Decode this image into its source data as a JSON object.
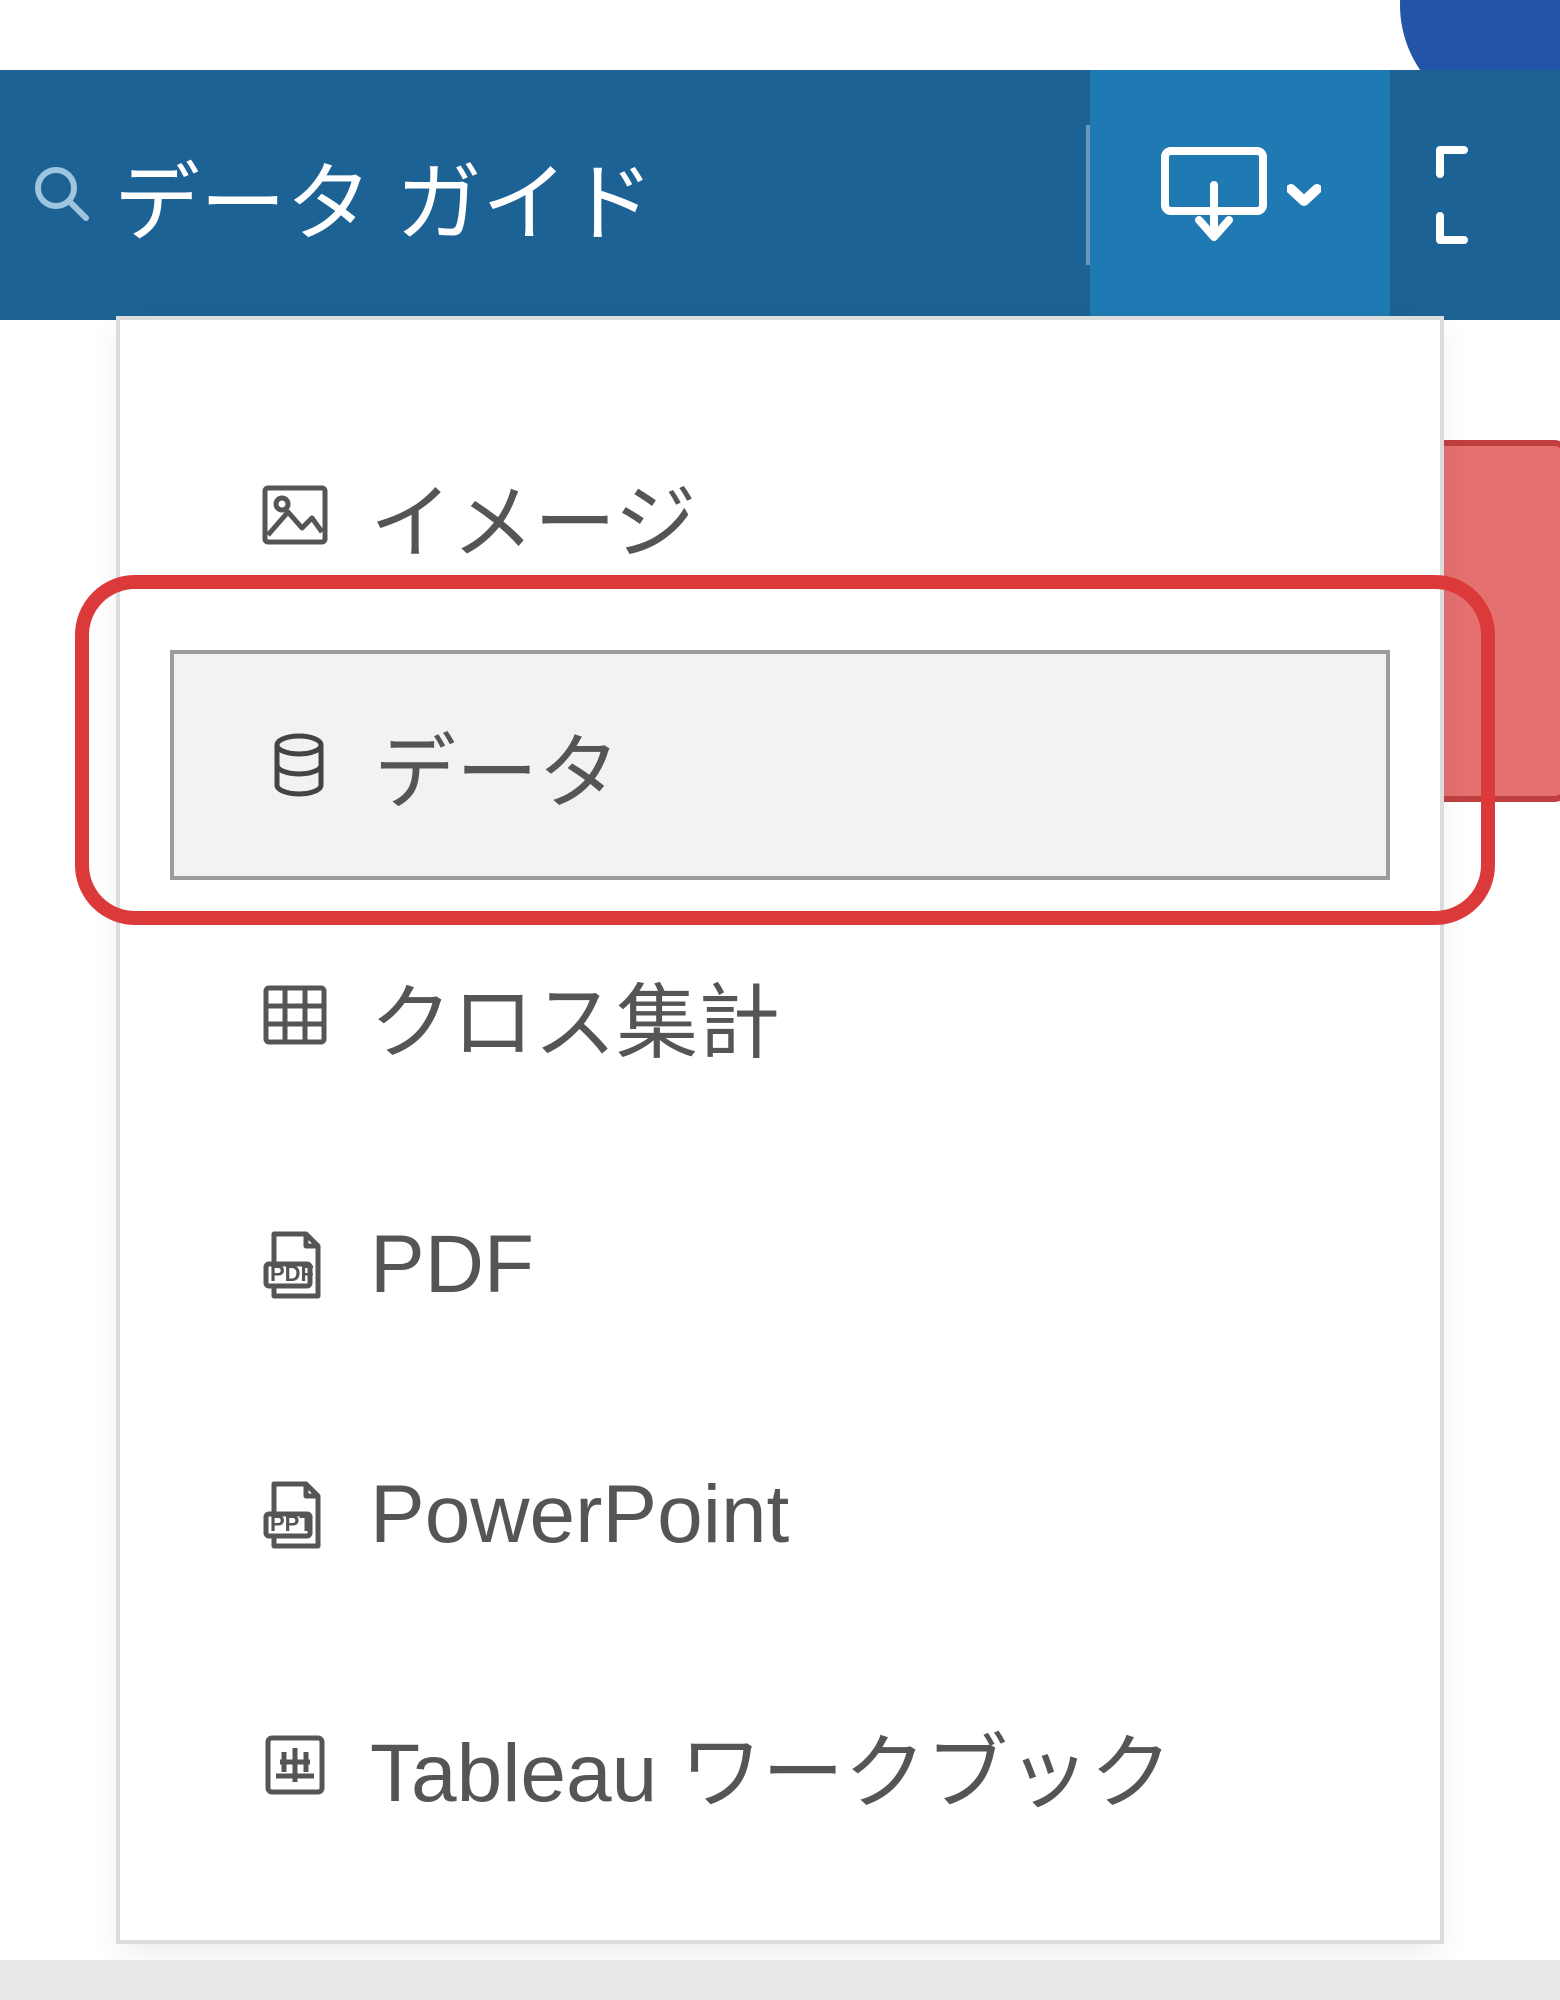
{
  "toolbar": {
    "data_guide_label": "データ ガイド"
  },
  "download_menu": {
    "items": [
      {
        "id": "image",
        "label": "イメージ",
        "icon": "image-icon"
      },
      {
        "id": "data",
        "label": "データ",
        "icon": "database-icon"
      },
      {
        "id": "crosstab",
        "label": "クロス集計",
        "icon": "crosstab-icon"
      },
      {
        "id": "pdf",
        "label": "PDF",
        "icon": "pdf-icon"
      },
      {
        "id": "powerpoint",
        "label": "PowerPoint",
        "icon": "powerpoint-icon"
      },
      {
        "id": "workbook",
        "label": "Tableau ワークブック",
        "icon": "workbook-icon"
      }
    ],
    "hovered_id": "data"
  },
  "annotation": {
    "highlights_item_id": "data"
  }
}
